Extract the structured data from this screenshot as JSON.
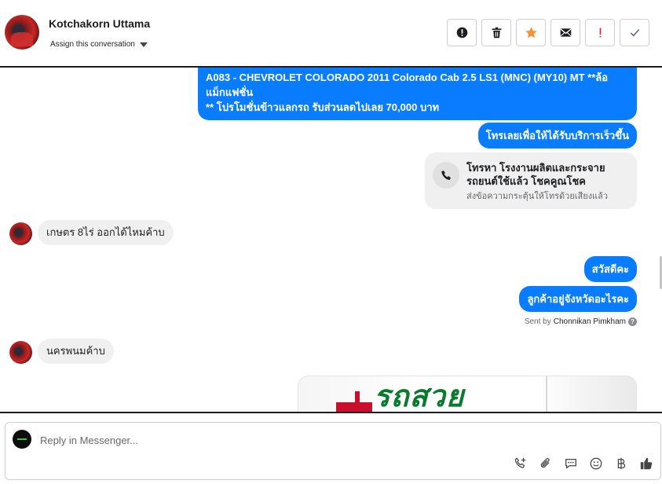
{
  "header": {
    "contact_name": "Kotchakorn Uttama",
    "assign_label": "Assign this conversation",
    "actions": [
      {
        "name": "mark-spam-button",
        "icon": "alert-circle-icon"
      },
      {
        "name": "delete-button",
        "icon": "trash-icon"
      },
      {
        "name": "star-button",
        "icon": "star-icon",
        "color": "#f7923a"
      },
      {
        "name": "mark-unread-button",
        "icon": "envelope-icon"
      },
      {
        "name": "follow-up-button",
        "icon": "exclamation-icon",
        "color": "#e02424"
      },
      {
        "name": "mark-done-button",
        "icon": "checkmark-icon"
      }
    ]
  },
  "messages": {
    "m1_line1": "A083 - CHEVROLET COLORADO 2011 Colorado Cab 2.5 LS1 (MNC) (MY10) MT **ล้อ",
    "m1_line2": "แม็กแฟชั่น",
    "m1_line3": "** โปรโมชั่นข้าวแลกรถ รับส่วนลดไปเลย 70,000 บาท",
    "m2": "โทรเลยเพื่อให้ได้รับบริการเร็วขึ้น",
    "call_title": "โทรหา โรงงานผลิตและกระจายรถยนต์ใช้แล้ว โชคคูณโชค",
    "call_sub": "ส่งข้อความกระตุ้นให้โทรด้วยเสียงแล้ว",
    "m3": "เกษตร 8ไร่ ออกได้ไหมค้าบ",
    "m4": "สวัสดีคะ",
    "m5": "ลูกค้าอยู่จังหวัดอะไรคะ",
    "sent_by_prefix": "Sent by",
    "sent_by_name": "Chonnikan Pimkham",
    "m6": "นครพนมค้าบ",
    "image_text": "รถสวย"
  },
  "composer": {
    "placeholder": "Reply in Messenger...",
    "tools": [
      "call-icon",
      "attachment-icon",
      "saved-reply-icon",
      "emoji-icon",
      "baht-icon",
      "like-icon"
    ]
  },
  "colors": {
    "outgoing_bubble": "#0a7cff",
    "incoming_bubble": "#f0f0f0",
    "star": "#f7923a",
    "alert": "#e02424"
  }
}
